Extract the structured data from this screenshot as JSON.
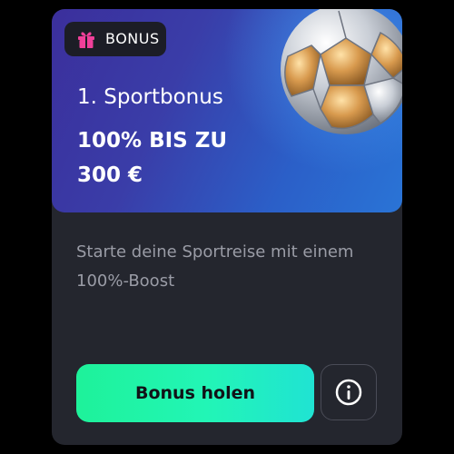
{
  "banner": {
    "badge_label": "BONUS",
    "title": "1. Sportbonus",
    "offer_line1": "100% BIS ZU",
    "offer_line2": "300 €"
  },
  "description": "Starte deine Sportreise mit einem 100%-Boost",
  "actions": {
    "primary_label": "Bonus holen",
    "info_icon": "info-icon"
  },
  "icons": {
    "badge_icon": "gift-icon",
    "banner_image": "soccer-ball-icon"
  },
  "colors": {
    "card_background": "#24262e",
    "banner_gradient_start": "#3b2f9c",
    "banner_gradient_end": "#2a74d6",
    "badge_background": "#1c1d26",
    "gift_color": "#f0409a",
    "cta_gradient_start": "#1ef29a",
    "cta_gradient_end": "#20e3d3",
    "description_text": "#9a9ca6"
  }
}
